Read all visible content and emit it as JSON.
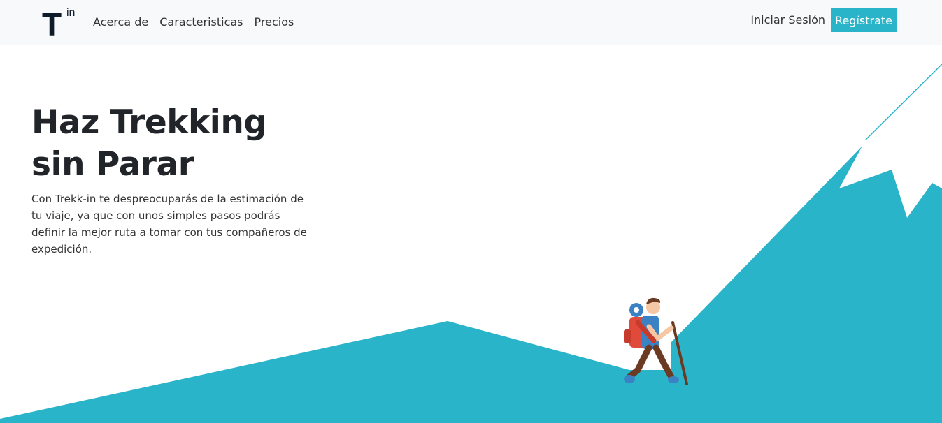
{
  "brand": {
    "letter": "T",
    "superscript": "in"
  },
  "nav": {
    "links": [
      "Acerca de",
      "Caracteristicas",
      "Precios"
    ],
    "login": "Iniciar Sesión",
    "signup": "Regístrate"
  },
  "hero": {
    "title": "Haz Trekking sin Parar",
    "text": "Con Trekk-in te despreocuparás de la estimación de tu viaje, ya que con unos simples pasos podrás definir la mejor ruta a tomar con tus compañeros de expedición."
  },
  "colors": {
    "accent": "#2ab4c9",
    "navbar_bg": "#f8f9fa"
  },
  "illustration": {
    "subject": "hiker-icon",
    "terrain": "mountain-illustration"
  }
}
